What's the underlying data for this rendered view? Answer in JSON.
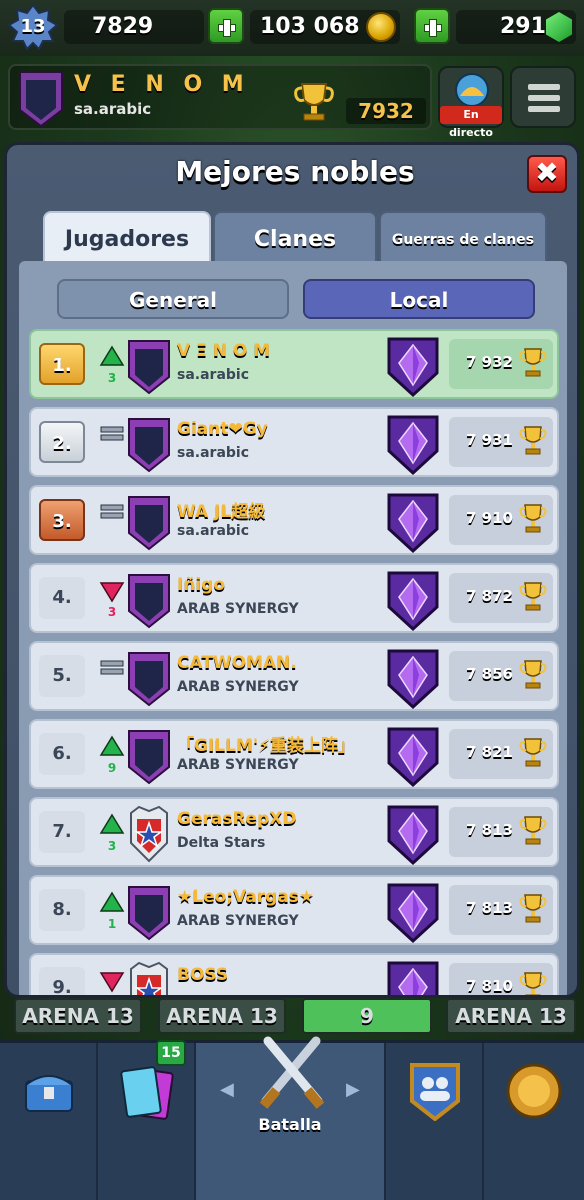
{
  "resources": {
    "level": "13",
    "stars": "7829",
    "gold": "103 068",
    "gems": "291"
  },
  "player": {
    "name": "V E N O M",
    "clan": "sa.arabic",
    "trophies": "7932",
    "live_label": "En directo"
  },
  "modal": {
    "title": "Mejores nobles",
    "close_label": "✖",
    "tabs": [
      {
        "label": "Jugadores",
        "active": true
      },
      {
        "label": "Clanes",
        "active": false
      },
      {
        "label": "Guerras de clanes",
        "active": false
      }
    ],
    "segments": [
      {
        "label": "General",
        "active": false
      },
      {
        "label": "Local",
        "active": true
      }
    ]
  },
  "leaderboard": [
    {
      "rank": "1.",
      "trend": "up",
      "change": "3",
      "name": "V Ξ N O M",
      "clan": "sa.arabic",
      "trophies": "7 932",
      "badge": "moon-badge"
    },
    {
      "rank": "2.",
      "trend": "same",
      "change": "",
      "name": "Giant❤Gy",
      "clan": "sa.arabic",
      "trophies": "7 931",
      "badge": "moon-badge"
    },
    {
      "rank": "3.",
      "trend": "same",
      "change": "",
      "name": "WA JL超級",
      "clan": "sa.arabic",
      "trophies": "7 910",
      "badge": "moon-badge"
    },
    {
      "rank": "4.",
      "trend": "down",
      "change": "3",
      "name": "Iñigo",
      "clan": "ARAB SYNERGY",
      "trophies": "7 872",
      "badge": "moon-badge"
    },
    {
      "rank": "5.",
      "trend": "same",
      "change": "",
      "name": "CATWOMAN.",
      "clan": "ARAB SYNERGY",
      "trophies": "7 856",
      "badge": "moon-badge"
    },
    {
      "rank": "6.",
      "trend": "up",
      "change": "9",
      "name": "「GILLM'⚡重装上阵」",
      "clan": "ARAB SYNERGY",
      "trophies": "7 821",
      "badge": "moon-badge"
    },
    {
      "rank": "7.",
      "trend": "up",
      "change": "3",
      "name": "GerasRepXD",
      "clan": "Delta Stars",
      "trophies": "7 813",
      "badge": "star-shield-badge"
    },
    {
      "rank": "8.",
      "trend": "up",
      "change": "1",
      "name": "★Leo;Vargas★",
      "clan": "ARAB SYNERGY",
      "trophies": "7 813",
      "badge": "moon-badge"
    },
    {
      "rank": "9.",
      "trend": "down",
      "change": "",
      "name": "BOSS",
      "clan": "",
      "trophies": "7 810",
      "badge": "star-shield-badge"
    }
  ],
  "arenas": [
    "ARENA 13",
    "ARENA 13",
    "9",
    "ARENA 13"
  ],
  "bottom_nav": {
    "items": [
      {
        "label": "",
        "icon": "shop-chest-icon"
      },
      {
        "label": "",
        "icon": "cards-icon",
        "badge": "15"
      },
      {
        "label": "Batalla",
        "icon": "crossed-swords-icon"
      },
      {
        "label": "",
        "icon": "clan-icon"
      },
      {
        "label": "",
        "icon": "events-icon"
      }
    ]
  },
  "colors": {
    "accent_gold": "#f4b93a",
    "active_segment": "#5a66b8",
    "close_red": "#d32019",
    "trend_up": "#22b34a",
    "trend_down": "#e0245e"
  }
}
